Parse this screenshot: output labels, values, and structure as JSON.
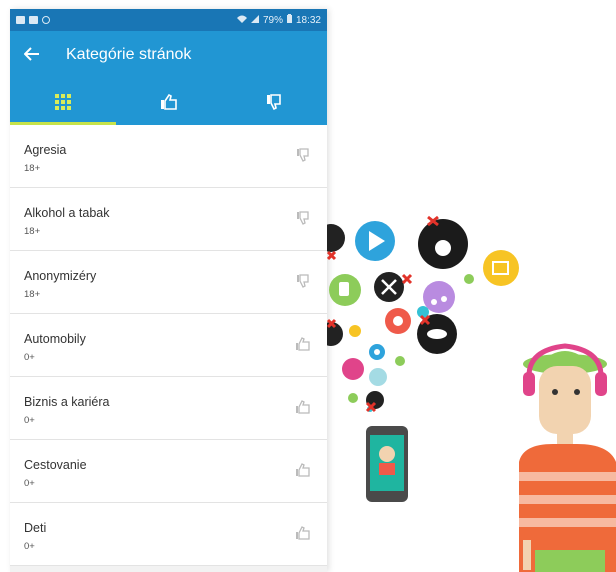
{
  "status_bar": {
    "right_text": "79%",
    "time": "18:32"
  },
  "app_bar": {
    "back_icon": "back-arrow-icon",
    "title": "Kategórie stránok"
  },
  "tabs": [
    {
      "icon": "grid-icon",
      "active": true
    },
    {
      "icon": "thumbs-up-icon",
      "active": false
    },
    {
      "icon": "thumbs-down-icon",
      "active": false
    }
  ],
  "categories": [
    {
      "name": "Agresia",
      "age": "18+",
      "icon": "thumbs-down-icon"
    },
    {
      "name": "Alkohol a tabak",
      "age": "18+",
      "icon": "thumbs-down-icon"
    },
    {
      "name": "Anonymizéry",
      "age": "18+",
      "icon": "thumbs-down-icon"
    },
    {
      "name": "Automobily",
      "age": "0+",
      "icon": "thumbs-up-icon"
    },
    {
      "name": "Biznis a kariéra",
      "age": "0+",
      "icon": "thumbs-up-icon"
    },
    {
      "name": "Cestovanie",
      "age": "0+",
      "icon": "thumbs-up-icon"
    },
    {
      "name": "Deti",
      "age": "0+",
      "icon": "thumbs-up-icon"
    }
  ],
  "colors": {
    "status_bar": "#1976b5",
    "app_bar": "#2196d3",
    "tab_indicator": "#c7e34a"
  }
}
